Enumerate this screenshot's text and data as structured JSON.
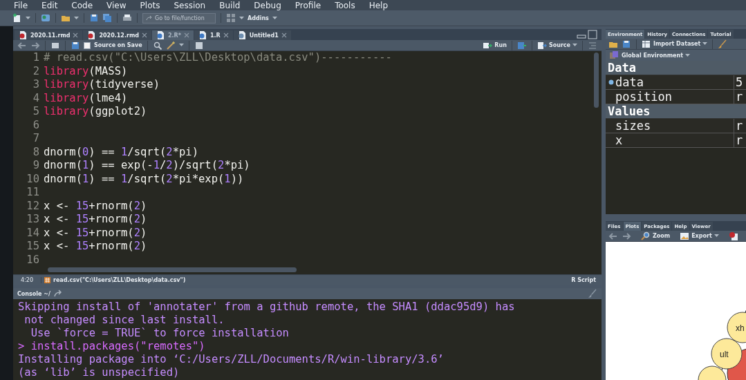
{
  "menu_bar": [
    "File",
    "Edit",
    "Code",
    "View",
    "Plots",
    "Session",
    "Build",
    "Debug",
    "Profile",
    "Tools",
    "Help"
  ],
  "toolbar": {
    "goto_placeholder": "Go to file/function",
    "addins": "Addins"
  },
  "editor": {
    "tabs": [
      {
        "label": "2020.11.rmd",
        "kind": "rmd",
        "selected": false
      },
      {
        "label": "2020.12.rmd",
        "kind": "rmd",
        "selected": false
      },
      {
        "label": "2.R*",
        "kind": "r",
        "selected": true
      },
      {
        "label": "1.R",
        "kind": "r",
        "selected": false
      },
      {
        "label": "Untitled1",
        "kind": "plain",
        "selected": false
      }
    ],
    "source_on_save": {
      "label": "Source on Save",
      "checked": false
    },
    "run": "Run",
    "source": "Source",
    "lines": [
      {
        "number": "1",
        "segments": [
          {
            "kind": "comment",
            "text": "# read.csv(\"C:\\Users\\ZLL\\Desktop\\data.csv\")-----------"
          }
        ]
      },
      {
        "number": "2",
        "segments": [
          {
            "kind": "fn",
            "text": "library"
          },
          {
            "kind": "plain",
            "text": "(MASS)"
          }
        ]
      },
      {
        "number": "3",
        "segments": [
          {
            "kind": "fn",
            "text": "library"
          },
          {
            "kind": "plain",
            "text": "(tidyverse)"
          }
        ]
      },
      {
        "number": "4",
        "segments": [
          {
            "kind": "fn",
            "text": "library"
          },
          {
            "kind": "plain",
            "text": "(lme4)"
          }
        ]
      },
      {
        "number": "5",
        "segments": [
          {
            "kind": "fn",
            "text": "library"
          },
          {
            "kind": "plain",
            "text": "(ggplot2)"
          }
        ]
      },
      {
        "number": "6"
      },
      {
        "number": "7"
      },
      {
        "number": "8",
        "segments": [
          {
            "kind": "plain",
            "text": "dnorm("
          },
          {
            "kind": "num",
            "text": "0"
          },
          {
            "kind": "plain",
            "text": ") == "
          },
          {
            "kind": "num",
            "text": "1"
          },
          {
            "kind": "plain",
            "text": "/sqrt("
          },
          {
            "kind": "num",
            "text": "2"
          },
          {
            "kind": "plain",
            "text": "*pi)"
          }
        ]
      },
      {
        "number": "9",
        "segments": [
          {
            "kind": "plain",
            "text": "dnorm("
          },
          {
            "kind": "num",
            "text": "1"
          },
          {
            "kind": "plain",
            "text": ") == exp(-"
          },
          {
            "kind": "num",
            "text": "1"
          },
          {
            "kind": "plain",
            "text": "/"
          },
          {
            "kind": "num",
            "text": "2"
          },
          {
            "kind": "plain",
            "text": ")/sqrt("
          },
          {
            "kind": "num",
            "text": "2"
          },
          {
            "kind": "plain",
            "text": "*pi)"
          }
        ]
      },
      {
        "number": "10",
        "segments": [
          {
            "kind": "plain",
            "text": "dnorm("
          },
          {
            "kind": "num",
            "text": "1"
          },
          {
            "kind": "plain",
            "text": ") == "
          },
          {
            "kind": "num",
            "text": "1"
          },
          {
            "kind": "plain",
            "text": "/sqrt("
          },
          {
            "kind": "num",
            "text": "2"
          },
          {
            "kind": "plain",
            "text": "*pi*exp("
          },
          {
            "kind": "num",
            "text": "1"
          },
          {
            "kind": "plain",
            "text": "))"
          }
        ]
      },
      {
        "number": "11"
      },
      {
        "number": "12",
        "segments": [
          {
            "kind": "plain",
            "text": "x <- "
          },
          {
            "kind": "num",
            "text": "15"
          },
          {
            "kind": "plain",
            "text": "+rnorm("
          },
          {
            "kind": "num",
            "text": "2"
          },
          {
            "kind": "plain",
            "text": ")"
          }
        ]
      },
      {
        "number": "13",
        "segments": [
          {
            "kind": "plain",
            "text": "x <- "
          },
          {
            "kind": "num",
            "text": "15"
          },
          {
            "kind": "plain",
            "text": "+rnorm("
          },
          {
            "kind": "num",
            "text": "2"
          },
          {
            "kind": "plain",
            "text": ")"
          }
        ]
      },
      {
        "number": "14",
        "segments": [
          {
            "kind": "plain",
            "text": "x <- "
          },
          {
            "kind": "num",
            "text": "15"
          },
          {
            "kind": "plain",
            "text": "+rnorm("
          },
          {
            "kind": "num",
            "text": "2"
          },
          {
            "kind": "plain",
            "text": ")"
          }
        ]
      },
      {
        "number": "15",
        "segments": [
          {
            "kind": "plain",
            "text": "x <- "
          },
          {
            "kind": "num",
            "text": "15"
          },
          {
            "kind": "plain",
            "text": "+rnorm("
          },
          {
            "kind": "num",
            "text": "2"
          },
          {
            "kind": "plain",
            "text": ")"
          }
        ]
      },
      {
        "number": "16"
      }
    ],
    "status": {
      "position": "4:20",
      "section": "read.csv(\"C:\\Users\\ZLL\\Desktop\\data.csv\")",
      "file_type": "R Script"
    }
  },
  "console": {
    "title": "Console ~/",
    "lines": [
      {
        "kind": "message",
        "text": "Skipping install of 'annotater' from a github remote, the SHA1 (ddac95d9) has"
      },
      {
        "kind": "message",
        "text": " not changed since last install."
      },
      {
        "kind": "message",
        "text": "  Use `force = TRUE` to force installation"
      },
      {
        "kind": "input",
        "text": "> install.packages(\"remotes\")"
      },
      {
        "kind": "message",
        "text": "Installing package into ‘C:/Users/ZLL/Documents/R/win-library/3.6’"
      },
      {
        "kind": "message",
        "text": "(as ‘lib’ is unspecified)"
      }
    ]
  },
  "environment": {
    "tabs": [
      {
        "label": "Environment",
        "selected": true
      },
      {
        "label": "History",
        "selected": false
      },
      {
        "label": "Connections",
        "selected": false
      },
      {
        "label": "Tutorial",
        "selected": false
      }
    ],
    "import_dataset": "Import Dataset",
    "scope": "Global Environment",
    "sections": [
      {
        "title": "Data",
        "rows": [
          {
            "name": "data",
            "value": "5",
            "expandable": true
          },
          {
            "name": "position",
            "value": "r",
            "expandable": false
          }
        ]
      },
      {
        "title": "Values",
        "rows": [
          {
            "name": "sizes",
            "value": "r",
            "expandable": false
          },
          {
            "name": "x",
            "value": "r",
            "expandable": false
          }
        ]
      }
    ]
  },
  "files": {
    "tabs": [
      {
        "label": "Files",
        "selected": false
      },
      {
        "label": "Plots",
        "selected": true
      },
      {
        "label": "Packages",
        "selected": false
      },
      {
        "label": "Help",
        "selected": false
      },
      {
        "label": "Viewer",
        "selected": false
      }
    ],
    "zoom": "Zoom",
    "export": "Export",
    "plot_labels": [
      "xh",
      "ult"
    ]
  }
}
